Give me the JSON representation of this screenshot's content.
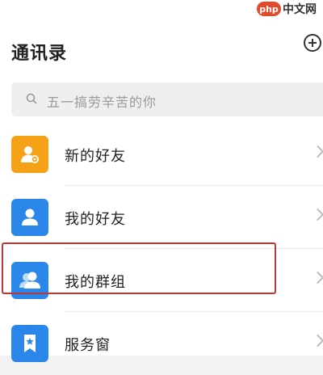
{
  "watermark": {
    "badge": "php",
    "text": "中文网"
  },
  "header": {
    "title": "通讯录",
    "add_icon": "plus-circle-icon"
  },
  "search": {
    "placeholder": "五一搞劳辛苦的你",
    "icon": "search-icon"
  },
  "contacts": {
    "items": [
      {
        "label": "新的好友",
        "icon": "new-friend-icon",
        "color": "#f5a219"
      },
      {
        "label": "我的好友",
        "icon": "person-icon",
        "color": "#2a86e8"
      },
      {
        "label": "我的群组",
        "icon": "group-icon",
        "color": "#2a86e8",
        "highlighted": true
      },
      {
        "label": "服务窗",
        "icon": "bookmark-icon",
        "color": "#2a86e8"
      }
    ]
  },
  "colors": {
    "highlight_border": "#b73a3a",
    "accent_blue": "#2a86e8",
    "accent_orange": "#f5a219"
  }
}
